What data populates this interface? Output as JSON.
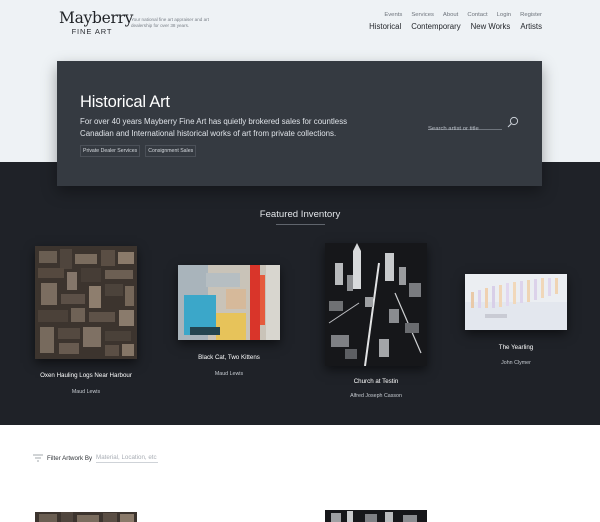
{
  "brand": {
    "name": "Mayberry",
    "sub": "FINE ART",
    "tagline": "Your national fine art appraiser and art dealership for over 38 years."
  },
  "nav": {
    "utility": [
      "Events",
      "Services",
      "About",
      "Contact",
      "Login",
      "Register"
    ],
    "main": [
      "Historical",
      "Contemporary",
      "New Works",
      "Artists"
    ]
  },
  "hero": {
    "title": "Historical Art",
    "description": "For over 40 years Mayberry Fine Art has quietly brokered sales for countless Canadian and International historical works of art from private collections.",
    "tags": [
      "Private Dealer Services",
      "Consignment Sales"
    ],
    "search_placeholder": "Search artist or title"
  },
  "featured": {
    "title": "Featured Inventory",
    "items": [
      {
        "title": "Oxen Hauling Logs Near Harbour",
        "artist": "Maud Lewis"
      },
      {
        "title": "Black Cat, Two Kittens",
        "artist": "Maud Lewis"
      },
      {
        "title": "Church at Testin",
        "artist": "Alfred Joseph Casson"
      },
      {
        "title": "The Yearling",
        "artist": "John Clymer"
      }
    ]
  },
  "filter": {
    "label": "Filter Artwork By",
    "placeholder": "Material, Location, etc"
  },
  "icons": {
    "search": "search-icon",
    "filter": "filter-icon"
  },
  "colors": {
    "header_bg": "#eef2f5",
    "hero_bg": "#353a41",
    "dark_band": "#1f2228",
    "white": "#ffffff"
  }
}
